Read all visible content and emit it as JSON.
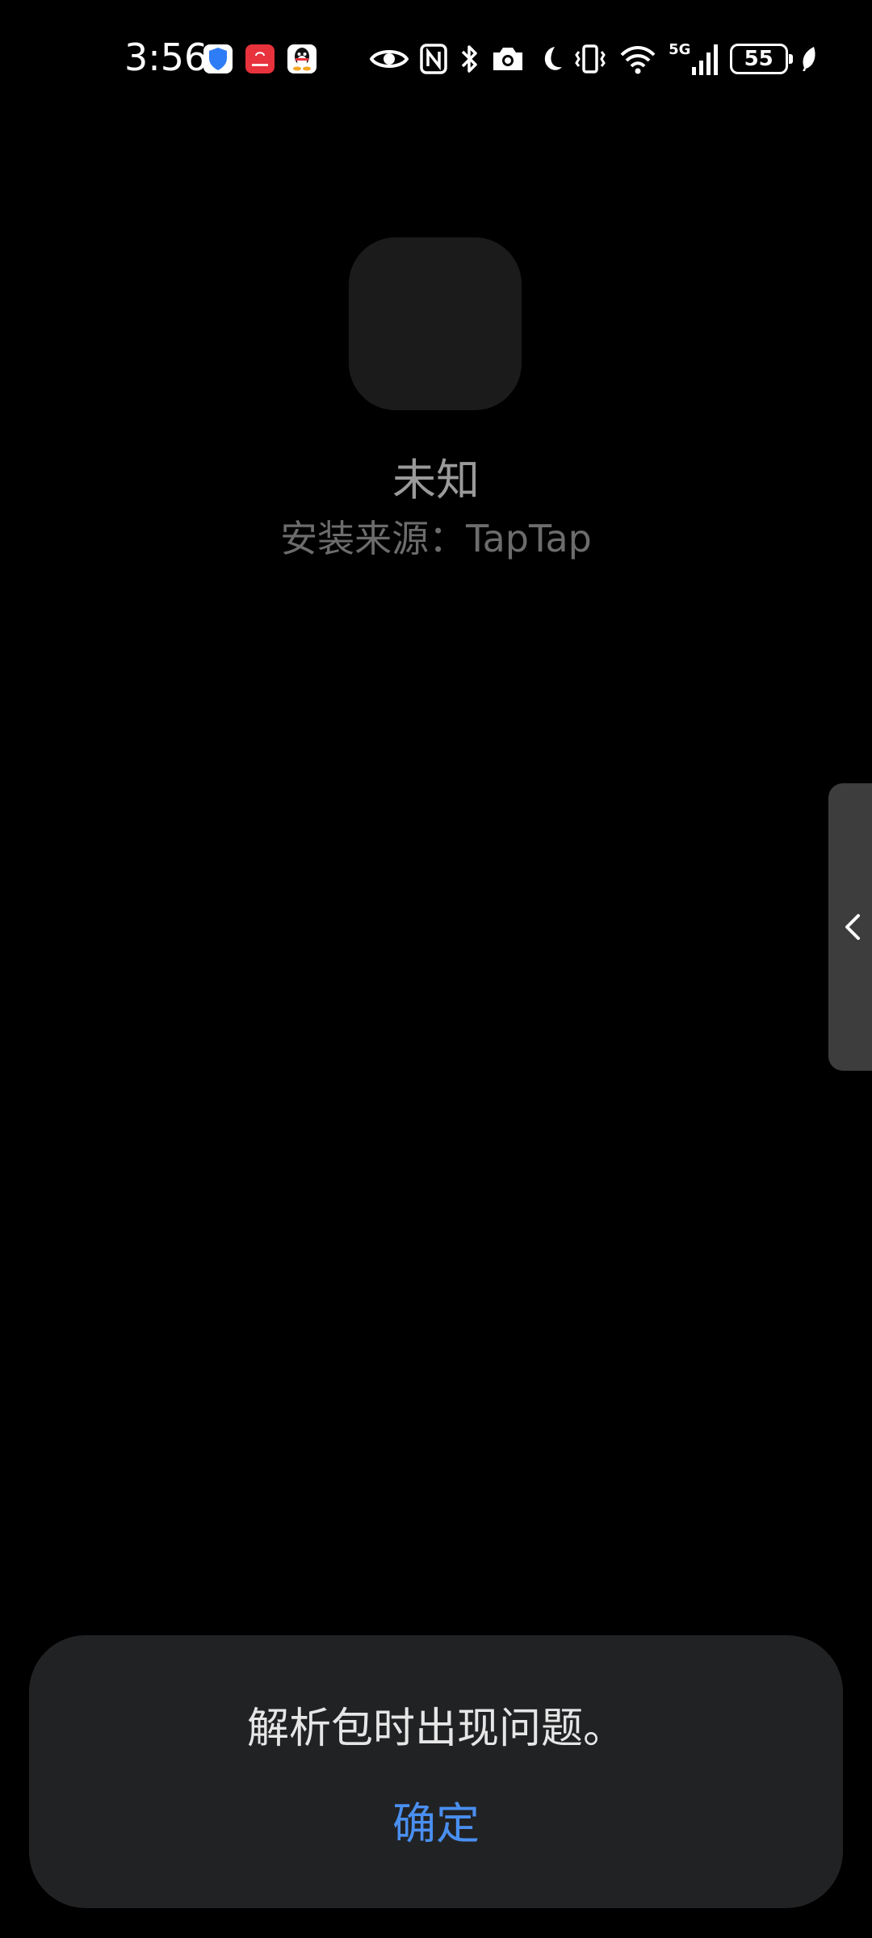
{
  "status_bar": {
    "time": "3:56",
    "battery_level": "55",
    "notification_icons": [
      "shield-app-icon",
      "huawei-store-icon",
      "qq-penguin-icon"
    ],
    "system_icons": [
      "eye-comfort-icon",
      "nfc-icon",
      "bluetooth-icon",
      "camera-icon",
      "moon-icon",
      "vibrate-icon",
      "wifi-icon",
      "5g-signal-icon",
      "battery-icon",
      "leaf-icon"
    ],
    "network_label": "5G",
    "colors": {
      "shield": "#2f7df6",
      "huawei": "#e8323c",
      "qq": "#ffffff"
    }
  },
  "app": {
    "name": "未知",
    "install_source": "安装来源：TapTap"
  },
  "dialog": {
    "message": "解析包时出现问题。",
    "confirm_label": "确定",
    "confirm_color": "#4a8ff0"
  },
  "side_handle": {
    "icon": "chevron-left-icon"
  }
}
